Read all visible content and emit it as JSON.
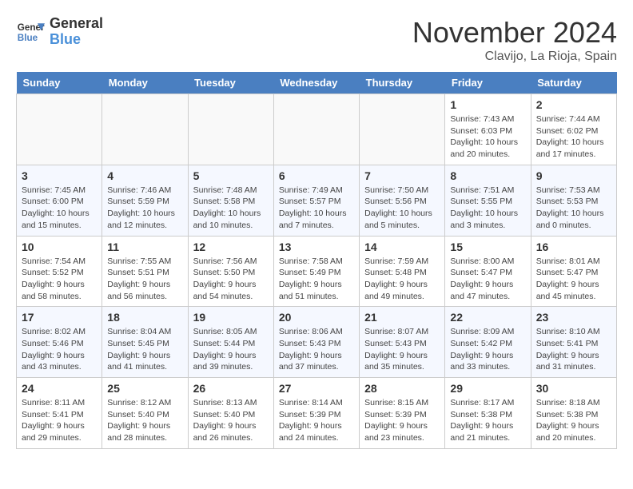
{
  "header": {
    "logo_line1": "General",
    "logo_line2": "Blue",
    "month": "November 2024",
    "location": "Clavijo, La Rioja, Spain"
  },
  "weekdays": [
    "Sunday",
    "Monday",
    "Tuesday",
    "Wednesday",
    "Thursday",
    "Friday",
    "Saturday"
  ],
  "weeks": [
    [
      {
        "day": "",
        "info": ""
      },
      {
        "day": "",
        "info": ""
      },
      {
        "day": "",
        "info": ""
      },
      {
        "day": "",
        "info": ""
      },
      {
        "day": "",
        "info": ""
      },
      {
        "day": "1",
        "info": "Sunrise: 7:43 AM\nSunset: 6:03 PM\nDaylight: 10 hours\nand 20 minutes."
      },
      {
        "day": "2",
        "info": "Sunrise: 7:44 AM\nSunset: 6:02 PM\nDaylight: 10 hours\nand 17 minutes."
      }
    ],
    [
      {
        "day": "3",
        "info": "Sunrise: 7:45 AM\nSunset: 6:00 PM\nDaylight: 10 hours\nand 15 minutes."
      },
      {
        "day": "4",
        "info": "Sunrise: 7:46 AM\nSunset: 5:59 PM\nDaylight: 10 hours\nand 12 minutes."
      },
      {
        "day": "5",
        "info": "Sunrise: 7:48 AM\nSunset: 5:58 PM\nDaylight: 10 hours\nand 10 minutes."
      },
      {
        "day": "6",
        "info": "Sunrise: 7:49 AM\nSunset: 5:57 PM\nDaylight: 10 hours\nand 7 minutes."
      },
      {
        "day": "7",
        "info": "Sunrise: 7:50 AM\nSunset: 5:56 PM\nDaylight: 10 hours\nand 5 minutes."
      },
      {
        "day": "8",
        "info": "Sunrise: 7:51 AM\nSunset: 5:55 PM\nDaylight: 10 hours\nand 3 minutes."
      },
      {
        "day": "9",
        "info": "Sunrise: 7:53 AM\nSunset: 5:53 PM\nDaylight: 10 hours\nand 0 minutes."
      }
    ],
    [
      {
        "day": "10",
        "info": "Sunrise: 7:54 AM\nSunset: 5:52 PM\nDaylight: 9 hours\nand 58 minutes."
      },
      {
        "day": "11",
        "info": "Sunrise: 7:55 AM\nSunset: 5:51 PM\nDaylight: 9 hours\nand 56 minutes."
      },
      {
        "day": "12",
        "info": "Sunrise: 7:56 AM\nSunset: 5:50 PM\nDaylight: 9 hours\nand 54 minutes."
      },
      {
        "day": "13",
        "info": "Sunrise: 7:58 AM\nSunset: 5:49 PM\nDaylight: 9 hours\nand 51 minutes."
      },
      {
        "day": "14",
        "info": "Sunrise: 7:59 AM\nSunset: 5:48 PM\nDaylight: 9 hours\nand 49 minutes."
      },
      {
        "day": "15",
        "info": "Sunrise: 8:00 AM\nSunset: 5:47 PM\nDaylight: 9 hours\nand 47 minutes."
      },
      {
        "day": "16",
        "info": "Sunrise: 8:01 AM\nSunset: 5:47 PM\nDaylight: 9 hours\nand 45 minutes."
      }
    ],
    [
      {
        "day": "17",
        "info": "Sunrise: 8:02 AM\nSunset: 5:46 PM\nDaylight: 9 hours\nand 43 minutes."
      },
      {
        "day": "18",
        "info": "Sunrise: 8:04 AM\nSunset: 5:45 PM\nDaylight: 9 hours\nand 41 minutes."
      },
      {
        "day": "19",
        "info": "Sunrise: 8:05 AM\nSunset: 5:44 PM\nDaylight: 9 hours\nand 39 minutes."
      },
      {
        "day": "20",
        "info": "Sunrise: 8:06 AM\nSunset: 5:43 PM\nDaylight: 9 hours\nand 37 minutes."
      },
      {
        "day": "21",
        "info": "Sunrise: 8:07 AM\nSunset: 5:43 PM\nDaylight: 9 hours\nand 35 minutes."
      },
      {
        "day": "22",
        "info": "Sunrise: 8:09 AM\nSunset: 5:42 PM\nDaylight: 9 hours\nand 33 minutes."
      },
      {
        "day": "23",
        "info": "Sunrise: 8:10 AM\nSunset: 5:41 PM\nDaylight: 9 hours\nand 31 minutes."
      }
    ],
    [
      {
        "day": "24",
        "info": "Sunrise: 8:11 AM\nSunset: 5:41 PM\nDaylight: 9 hours\nand 29 minutes."
      },
      {
        "day": "25",
        "info": "Sunrise: 8:12 AM\nSunset: 5:40 PM\nDaylight: 9 hours\nand 28 minutes."
      },
      {
        "day": "26",
        "info": "Sunrise: 8:13 AM\nSunset: 5:40 PM\nDaylight: 9 hours\nand 26 minutes."
      },
      {
        "day": "27",
        "info": "Sunrise: 8:14 AM\nSunset: 5:39 PM\nDaylight: 9 hours\nand 24 minutes."
      },
      {
        "day": "28",
        "info": "Sunrise: 8:15 AM\nSunset: 5:39 PM\nDaylight: 9 hours\nand 23 minutes."
      },
      {
        "day": "29",
        "info": "Sunrise: 8:17 AM\nSunset: 5:38 PM\nDaylight: 9 hours\nand 21 minutes."
      },
      {
        "day": "30",
        "info": "Sunrise: 8:18 AM\nSunset: 5:38 PM\nDaylight: 9 hours\nand 20 minutes."
      }
    ]
  ]
}
